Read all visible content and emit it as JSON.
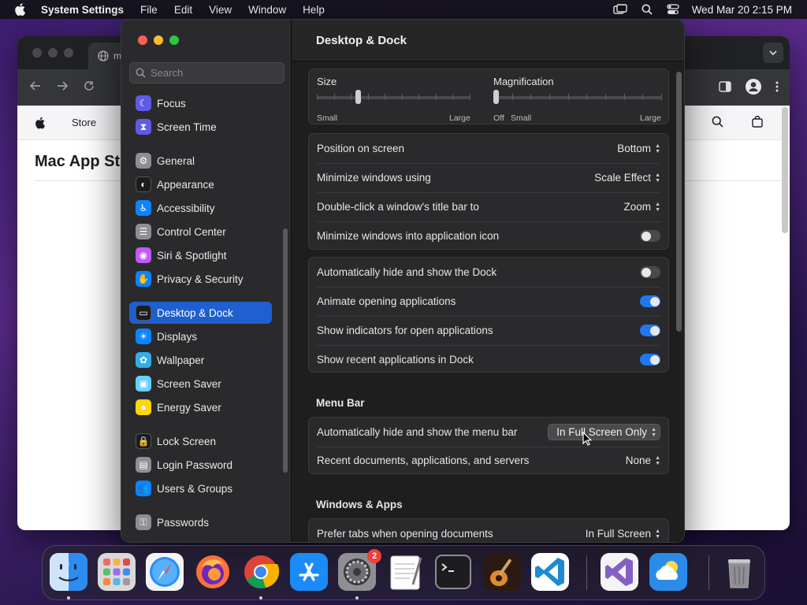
{
  "menubar": {
    "app_name": "System Settings",
    "menus": [
      "File",
      "Edit",
      "View",
      "Window",
      "Help"
    ],
    "clock": "Wed Mar 20  2:15 PM",
    "status_icons": [
      "screen-mirroring-icon",
      "search-icon",
      "control-center-icon"
    ]
  },
  "browser": {
    "tab_label": "m",
    "store_label": "Store",
    "page_title": "Mac App St"
  },
  "settings": {
    "search_placeholder": "Search",
    "sidebar": {
      "items": [
        {
          "label": "Focus",
          "icon": "moon-icon",
          "color": "#5e5ce6"
        },
        {
          "label": "Screen Time",
          "icon": "hourglass-icon",
          "color": "#5e5ce6"
        },
        {
          "label": "General",
          "icon": "gear-icon",
          "color": "#8e8e93"
        },
        {
          "label": "Appearance",
          "icon": "appearance-icon",
          "color": "#1c1c1e"
        },
        {
          "label": "Accessibility",
          "icon": "accessibility-icon",
          "color": "#0a84ff"
        },
        {
          "label": "Control Center",
          "icon": "control-center-icon",
          "color": "#8e8e93"
        },
        {
          "label": "Siri & Spotlight",
          "icon": "siri-icon",
          "color": "#bf5af2"
        },
        {
          "label": "Privacy & Security",
          "icon": "hand-icon",
          "color": "#0a84ff"
        },
        {
          "label": "Desktop & Dock",
          "icon": "dock-icon",
          "color": "#1c1c1e",
          "active": true
        },
        {
          "label": "Displays",
          "icon": "sun-icon",
          "color": "#0a84ff"
        },
        {
          "label": "Wallpaper",
          "icon": "flower-icon",
          "color": "#32ade6"
        },
        {
          "label": "Screen Saver",
          "icon": "screen-saver-icon",
          "color": "#64d2ff"
        },
        {
          "label": "Energy Saver",
          "icon": "bulb-icon",
          "color": "#ffd60a"
        },
        {
          "label": "Lock Screen",
          "icon": "lock-icon",
          "color": "#1c1c1e"
        },
        {
          "label": "Login Password",
          "icon": "lock-closed-icon",
          "color": "#8e8e93"
        },
        {
          "label": "Users & Groups",
          "icon": "users-icon",
          "color": "#0a84ff"
        },
        {
          "label": "Passwords",
          "icon": "key-icon",
          "color": "#8e8e93"
        }
      ]
    },
    "content": {
      "title": "Desktop & Dock",
      "size_slider": {
        "label": "Size",
        "min_caption": "Small",
        "max_caption": "Large",
        "value": 0.26
      },
      "magnification_slider": {
        "label": "Magnification",
        "off_caption": "Off",
        "min_caption": "Small",
        "max_caption": "Large",
        "value": 0.0
      },
      "dock_rows": [
        {
          "label": "Position on screen",
          "value": "Bottom"
        },
        {
          "label": "Minimize windows using",
          "value": "Scale Effect"
        },
        {
          "label": "Double-click a window's title bar to",
          "value": "Zoom"
        },
        {
          "label": "Minimize windows into application icon",
          "toggle": false
        }
      ],
      "dock_toggles": [
        {
          "label": "Automatically hide and show the Dock",
          "toggle": false
        },
        {
          "label": "Animate opening applications",
          "toggle": true
        },
        {
          "label": "Show indicators for open applications",
          "toggle": true
        },
        {
          "label": "Show recent applications in Dock",
          "toggle": true
        }
      ],
      "menu_bar_section": "Menu Bar",
      "menu_bar_rows": [
        {
          "label": "Automatically hide and show the menu bar",
          "value": "In Full Screen Only"
        },
        {
          "label": "Recent documents, applications, and servers",
          "value": "None"
        }
      ],
      "windows_section": "Windows & Apps",
      "windows_rows": [
        {
          "label": "Prefer tabs when opening documents",
          "value": "In Full Screen"
        }
      ]
    }
  },
  "dock": {
    "apps": [
      {
        "name": "finder-icon",
        "running": true
      },
      {
        "name": "launchpad-icon",
        "running": false
      },
      {
        "name": "safari-icon",
        "running": false
      },
      {
        "name": "firefox-icon",
        "running": false
      },
      {
        "name": "chrome-icon",
        "running": true
      },
      {
        "name": "app-store-icon",
        "running": false
      },
      {
        "name": "system-settings-icon",
        "running": true,
        "badge": "2"
      },
      {
        "name": "textedit-icon",
        "running": false
      },
      {
        "name": "terminal-icon",
        "running": false
      },
      {
        "name": "garageband-icon",
        "running": false
      },
      {
        "name": "vscode-icon",
        "running": false
      },
      {
        "name": "visual-studio-icon",
        "running": false
      },
      {
        "name": "weather-icon",
        "running": false
      },
      {
        "name": "trash-icon",
        "running": false
      }
    ]
  }
}
